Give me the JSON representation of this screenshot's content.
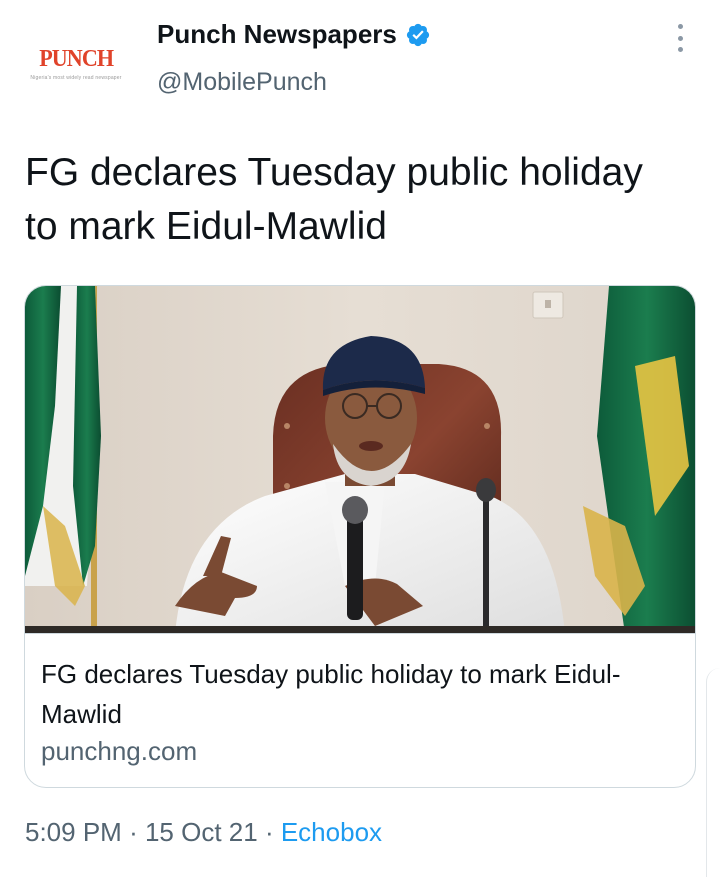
{
  "author": {
    "display_name": "Punch Newspapers",
    "handle": "@MobilePunch",
    "verified": true,
    "avatar_logo": "PUNCH",
    "avatar_tagline": "Nigeria's most widely read newspaper",
    "verified_icon": "verified-badge-icon",
    "more_icon": "more-vertical-icon"
  },
  "tweet": {
    "text": "FG declares Tuesday public holiday to mark Eidul-Mawlid"
  },
  "link_card": {
    "title": "FG declares Tuesday public holiday to mark Eidul-Mawlid",
    "domain": "punchng.com"
  },
  "meta": {
    "time": "5:09 PM",
    "separator": "·",
    "date": "15 Oct 21",
    "source": "Echobox"
  },
  "colors": {
    "text_primary": "#0f1419",
    "text_secondary": "#536471",
    "link": "#1d9bf0",
    "verified": "#1d9bf0",
    "border": "#cfd9de",
    "brand_red": "#e0432a"
  }
}
